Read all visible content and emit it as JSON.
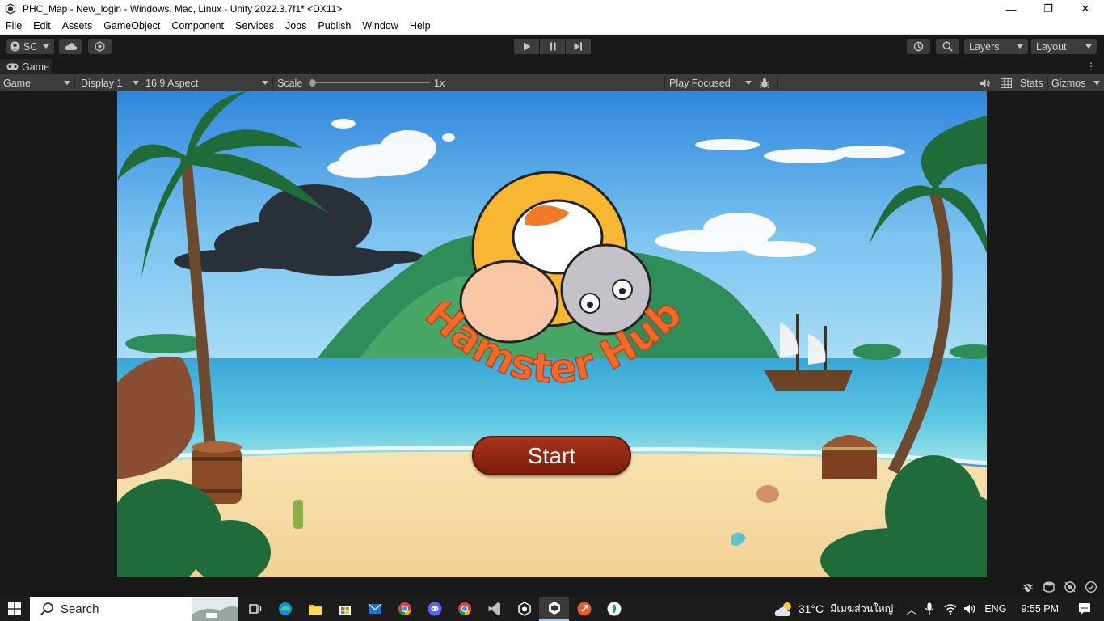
{
  "window": {
    "title": "PHC_Map - New_login - Windows, Mac, Linux - Unity 2022.3.7f1* <DX11>",
    "minimize": "—",
    "maximize": "❐",
    "close": "✕"
  },
  "menu": [
    "File",
    "Edit",
    "Assets",
    "GameObject",
    "Component",
    "Services",
    "Jobs",
    "Publish",
    "Window",
    "Help"
  ],
  "toolbar": {
    "account_label": "SC",
    "layers_label": "Layers",
    "layout_label": "Layout"
  },
  "tab": {
    "label": "Game"
  },
  "gamebar": {
    "mode": "Game",
    "display": "Display 1",
    "aspect": "16:9 Aspect",
    "scale_label": "Scale",
    "scale_value": "1x",
    "play_focused": "Play Focused",
    "stats": "Stats",
    "gizmos": "Gizmos"
  },
  "game": {
    "logo_text": "Hamster Hub",
    "start_label": "Start"
  },
  "taskbar": {
    "search_placeholder": "Search",
    "weather_temp": "31°C",
    "weather_text": "มีเมฆส่วนใหญ่",
    "language": "ENG",
    "time": "9:55 PM"
  },
  "colors": {
    "editor_bg": "#191919",
    "panel": "#3c3c3c",
    "start_button": "#8f2812",
    "logo_orange": "#f26a2a"
  }
}
